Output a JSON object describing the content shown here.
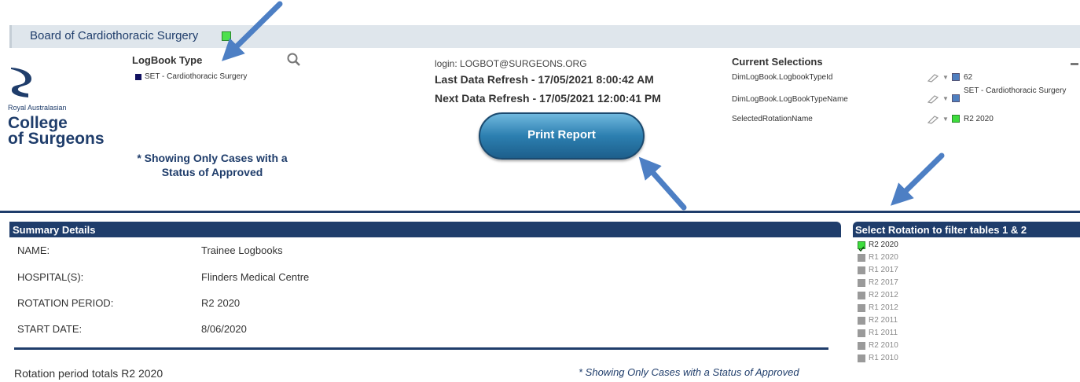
{
  "app": {
    "title": "Board of Cardiothoracic Surgery"
  },
  "logo": {
    "org": "Royal Australasian",
    "name_line1": "College",
    "name_line2": "of Surgeons"
  },
  "logbook_type": {
    "title": "LogBook Type",
    "selected": "SET - Cardiothoracic Surgery"
  },
  "approved_note": "* Showing Only Cases with a Status of Approved",
  "info": {
    "login": "login: LOGBOT@SURGEONS.ORG",
    "last_refresh": "Last Data Refresh  - 17/05/2021 8:00:42 AM",
    "next_refresh": "Next Data Refresh - 17/05/2021 12:00:41 PM"
  },
  "print_button": "Print Report",
  "current_selections": {
    "title": "Current Selections",
    "rows": [
      {
        "field": "DimLogBook.LogbookTypeId",
        "value": "62",
        "color": "#4f7fbf"
      },
      {
        "field": "DimLogBook.LogBookTypeName",
        "value": "SET - Cardiothoracic Surgery",
        "color": "#4f7fbf"
      },
      {
        "field": "SelectedRotationName",
        "value": "R2 2020",
        "color": "#3ddc3d"
      }
    ]
  },
  "summary": {
    "title": "Summary Details",
    "rows": [
      {
        "label": "NAME:",
        "value": "Trainee Logbooks"
      },
      {
        "label": "HOSPITAL(S):",
        "value": "Flinders Medical Centre"
      },
      {
        "label": "ROTATION PERIOD:",
        "value": "R2 2020"
      },
      {
        "label": "START DATE:",
        "value": "8/06/2020"
      }
    ],
    "rotation_totals": "Rotation period totals R2 2020",
    "approved_note": "* Showing Only Cases with a Status of Approved"
  },
  "rotation_filter": {
    "title": "Select Rotation to filter tables 1 & 2",
    "items": [
      {
        "label": "R2 2020",
        "selected": true
      },
      {
        "label": "R1 2020",
        "selected": false
      },
      {
        "label": "R1 2017",
        "selected": false
      },
      {
        "label": "R2 2017",
        "selected": false
      },
      {
        "label": "R2 2012",
        "selected": false
      },
      {
        "label": "R1 2012",
        "selected": false
      },
      {
        "label": "R2 2011",
        "selected": false
      },
      {
        "label": "R1 2011",
        "selected": false
      },
      {
        "label": "R2 2010",
        "selected": false
      },
      {
        "label": "R1 2010",
        "selected": false
      }
    ]
  },
  "colors": {
    "brand": "#1f3d6b",
    "selected_green": "#3ddc3d",
    "arrow": "#4d7fc4"
  }
}
